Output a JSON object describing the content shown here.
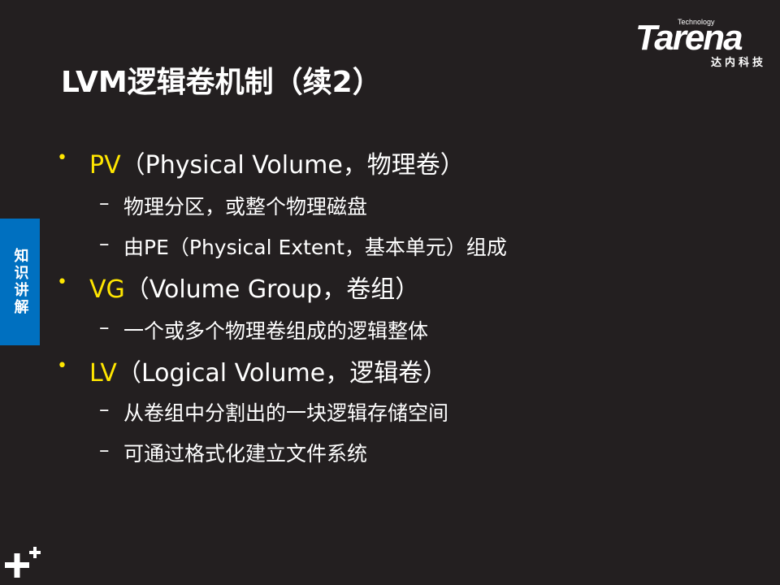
{
  "title": "LVM逻辑卷机制（续2）",
  "logo": {
    "small": "Technology",
    "word": "Tarena",
    "cn": "达内科技"
  },
  "side_tab": "知识讲解",
  "colors": {
    "background": "#231f20",
    "accent": "#ffe600",
    "tab": "#0070c0"
  },
  "items": [
    {
      "key": "PV",
      "rest": "（Physical Volume，物理卷）",
      "subs": [
        "物理分区，或整个物理磁盘",
        "由PE（Physical Extent，基本单元）组成"
      ]
    },
    {
      "key": "VG",
      "rest": "（Volume Group，卷组）",
      "subs": [
        "一个或多个物理卷组成的逻辑整体"
      ]
    },
    {
      "key": "LV",
      "rest": "（Logical Volume，逻辑卷）",
      "subs": [
        "从卷组中分割出的一块逻辑存储空间",
        "可通过格式化建立文件系统"
      ]
    }
  ],
  "bullet": "•",
  "dash": "–"
}
